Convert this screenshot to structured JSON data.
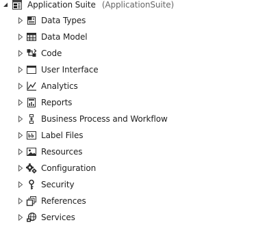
{
  "root": {
    "label": "Application Suite",
    "sublabel": "(ApplicationSuite)",
    "expanded": true,
    "icon": "project-icon"
  },
  "nodes": [
    {
      "label": "Data Types",
      "icon": "data-types-icon",
      "expanded": false
    },
    {
      "label": "Data Model",
      "icon": "table-grid-icon",
      "expanded": false
    },
    {
      "label": "Code",
      "icon": "code-flow-icon",
      "expanded": false
    },
    {
      "label": "User Interface",
      "icon": "window-icon",
      "expanded": false
    },
    {
      "label": "Analytics",
      "icon": "line-chart-icon",
      "expanded": false
    },
    {
      "label": "Reports",
      "icon": "report-icon",
      "expanded": false
    },
    {
      "label": "Business Process and Workflow",
      "icon": "workflow-icon",
      "expanded": false
    },
    {
      "label": "Label Files",
      "icon": "label-file-icon",
      "expanded": false
    },
    {
      "label": "Resources",
      "icon": "image-resource-icon",
      "expanded": false
    },
    {
      "label": "Configuration",
      "icon": "gear-icon",
      "expanded": false
    },
    {
      "label": "Security",
      "icon": "key-icon",
      "expanded": false
    },
    {
      "label": "References",
      "icon": "stacked-references-icon",
      "expanded": false
    },
    {
      "label": "Services",
      "icon": "globe-services-icon",
      "expanded": false
    }
  ]
}
